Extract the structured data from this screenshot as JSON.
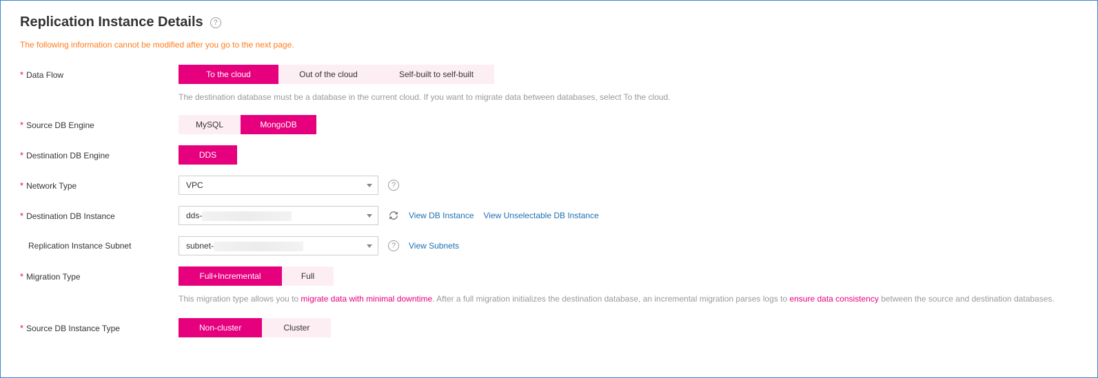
{
  "header": {
    "title": "Replication Instance Details"
  },
  "warning": "The following information cannot be modified after you go to the next page.",
  "labels": {
    "dataFlow": "Data Flow",
    "sourceDbEngine": "Source DB Engine",
    "destDbEngine": "Destination DB Engine",
    "networkType": "Network Type",
    "destDbInstance": "Destination DB Instance",
    "replicationSubnet": "Replication Instance Subnet",
    "migrationType": "Migration Type",
    "sourceDbInstanceType": "Source DB Instance Type"
  },
  "dataFlow": {
    "options": {
      "toCloud": "To the cloud",
      "outCloud": "Out of the cloud",
      "selfBuilt": "Self-built to self-built"
    },
    "hint": "The destination database must be a database in the current cloud. If you want to migrate data between databases, select To the cloud."
  },
  "sourceEngine": {
    "mysql": "MySQL",
    "mongodb": "MongoDB"
  },
  "destEngine": {
    "dds": "DDS"
  },
  "networkType": {
    "selected": "VPC"
  },
  "destInstance": {
    "prefix": "dds-",
    "viewLink": "View DB Instance",
    "viewUnselectableLink": "View Unselectable DB Instance"
  },
  "subnet": {
    "prefix": "subnet-",
    "viewLink": "View Subnets"
  },
  "migrationType": {
    "fullInc": "Full+Incremental",
    "full": "Full",
    "hintPre": "This migration type allows you to ",
    "hintHi1": "migrate data with minimal downtime",
    "hintMid": ". After a full migration initializes the destination database, an incremental migration parses logs to ",
    "hintHi2": "ensure data consistency",
    "hintPost": " between the source and destination databases."
  },
  "sourceInstanceType": {
    "nonCluster": "Non-cluster",
    "cluster": "Cluster"
  }
}
